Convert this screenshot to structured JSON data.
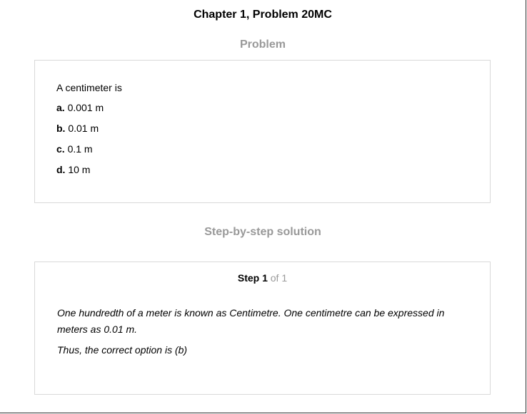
{
  "header": {
    "title": "Chapter 1, Problem 20MC"
  },
  "problem": {
    "heading": "Problem",
    "question": "A centimeter is",
    "options": [
      {
        "letter": "a.",
        "text": "0.001 m"
      },
      {
        "letter": "b.",
        "text": "0.01 m"
      },
      {
        "letter": "c.",
        "text": "0.1 m"
      },
      {
        "letter": "d.",
        "text": "10 m"
      }
    ]
  },
  "solution": {
    "heading": "Step-by-step solution",
    "step_label": "Step 1",
    "step_of": "of 1",
    "paragraphs": [
      "One hundredth of a meter is known as Centimetre. One centimetre can be expressed in meters as 0.01 m.",
      "Thus, the correct option is (b)"
    ]
  },
  "colors": {
    "heading_gray": "#999999",
    "border_gray": "#d9d9d9"
  }
}
